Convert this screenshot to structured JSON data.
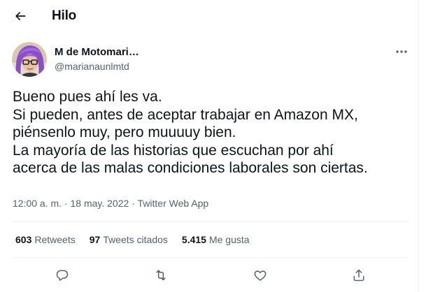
{
  "header": {
    "title": "Hilo"
  },
  "author": {
    "name": "M de Motomari…",
    "handle": "@marianaunlmtd"
  },
  "tweet": {
    "lines": [
      "Bueno pues ahí les va.",
      "Si pueden, antes de aceptar trabajar en Amazon MX,",
      "piénsenlo muy, pero muuuuy bien.",
      "La mayoría de las historias que escuchan por ahí",
      "acerca de las malas condiciones laborales son ciertas."
    ],
    "time": "12:00 a. m.",
    "separator": "·",
    "date": "18 may. 2022",
    "source": "Twitter Web App"
  },
  "stats": {
    "retweets_count": "603",
    "retweets_label": "Retweets",
    "quotes_count": "97",
    "quotes_label": "Tweets citados",
    "likes_count": "5.415",
    "likes_label": "Me gusta"
  },
  "icons": {
    "back": "arrow-left-icon",
    "more": "more-horizontal-icon",
    "reply": "reply-icon",
    "retweet": "retweet-icon",
    "like": "heart-icon",
    "share": "share-icon"
  },
  "colors": {
    "text_primary": "#0f1419",
    "text_secondary": "#536471",
    "divider": "#eff3f4"
  }
}
